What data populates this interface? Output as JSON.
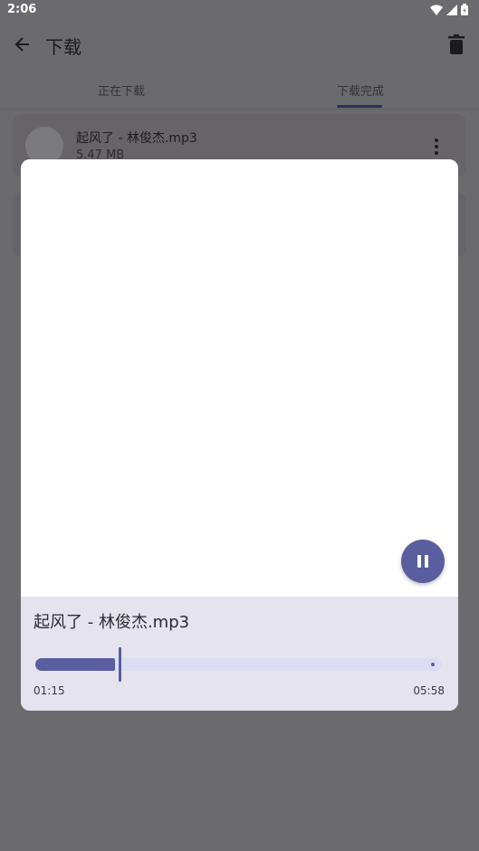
{
  "status_bar": {
    "time": "2:06"
  },
  "app_bar": {
    "title": "下载"
  },
  "tabs": [
    {
      "label": "正在下载"
    },
    {
      "label": "下载完成"
    }
  ],
  "list": [
    {
      "title": "起风了 - 林俊杰.mp3",
      "size": "5.47 MB"
    }
  ],
  "player": {
    "title": "起风了 - 林俊杰.mp3",
    "current_time": "01:15",
    "total_time": "05:58",
    "progress_fraction": 0.209,
    "state": "playing"
  },
  "colors": {
    "accent": "#5a5e9e",
    "track": "#dcdcf2",
    "controls_bg": "#e5e3ee"
  }
}
